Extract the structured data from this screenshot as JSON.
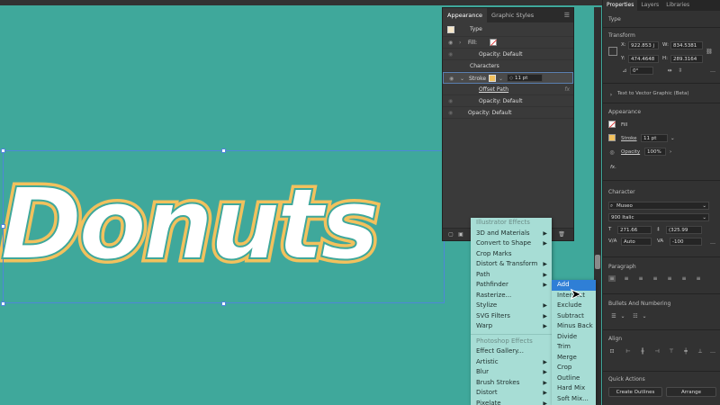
{
  "canvas": {
    "word": "Donuts"
  },
  "appearance": {
    "tabs": [
      "Appearance",
      "Graphic Styles"
    ],
    "rows": {
      "type": "Type",
      "fill": "Fill:",
      "opacity1": "Opacity: Default",
      "characters": "Characters",
      "stroke": "Stroke",
      "stroke_value": "11 pt",
      "offset_path": "Offset Path",
      "opacity2": "Opacity: Default",
      "opacity3": "Opacity: Default",
      "fx": "fx"
    }
  },
  "effect_menu": {
    "items": [
      {
        "label": "Illustrator Effects",
        "header": true
      },
      {
        "label": "3D and Materials",
        "sub": true
      },
      {
        "label": "Convert to Shape",
        "sub": true
      },
      {
        "label": "Crop Marks",
        "sub": false
      },
      {
        "label": "Distort & Transform",
        "sub": true
      },
      {
        "label": "Path",
        "sub": true
      },
      {
        "label": "Pathfinder",
        "sub": true
      },
      {
        "label": "Rasterize...",
        "sub": false
      },
      {
        "label": "Stylize",
        "sub": true
      },
      {
        "label": "SVG Filters",
        "sub": true
      },
      {
        "label": "Warp",
        "sub": true
      },
      {
        "label": "Photoshop Effects",
        "header": true
      },
      {
        "label": "Effect Gallery...",
        "sub": false
      },
      {
        "label": "Artistic",
        "sub": true
      },
      {
        "label": "Blur",
        "sub": true
      },
      {
        "label": "Brush Strokes",
        "sub": true
      },
      {
        "label": "Distort",
        "sub": true
      },
      {
        "label": "Pixelate",
        "sub": true
      }
    ]
  },
  "pathfinder_menu": {
    "items": [
      "Add",
      "Intersect",
      "Exclude",
      "Subtract",
      "Minus Back",
      "Divide",
      "Trim",
      "Merge",
      "Crop",
      "Outline",
      "Hard Mix",
      "Soft Mix..."
    ],
    "highlighted": "Add"
  },
  "properties": {
    "tabs": [
      "Properties",
      "Layers",
      "Libraries"
    ],
    "type_label": "Type",
    "transform": {
      "title": "Transform",
      "x_label": "X:",
      "x": "922.853 j",
      "w_label": "W:",
      "w": "834.5381",
      "y_label": "Y:",
      "y": "474.4648",
      "h_label": "H:",
      "h": "289.3164",
      "angle": "0°"
    },
    "text_to_vector": "Text to Vector Graphic (Beta)",
    "appearance": {
      "title": "Appearance",
      "fill": "Fill",
      "stroke": "Stroke",
      "stroke_value": "11 pt",
      "opacity_label": "Opacity",
      "opacity_value": "100%"
    },
    "fx_label": "fx.",
    "character": {
      "title": "Character",
      "font": "Museo",
      "style": "900 Italic",
      "size": "271.66",
      "leading": "(325.99",
      "kerning": "Auto",
      "tracking": "-100"
    },
    "paragraph": {
      "title": "Paragraph"
    },
    "bullets": {
      "title": "Bullets And Numbering"
    },
    "align": {
      "title": "Align"
    },
    "quick_actions": {
      "title": "Quick Actions",
      "create_outlines": "Create Outlines",
      "arrange": "Arrange"
    }
  },
  "colors": {
    "canvas_bg": "#3fa89b",
    "text_outline": "#f2c15d",
    "menu_bg": "#a7ddd5",
    "highlight": "#2f7fd6"
  }
}
